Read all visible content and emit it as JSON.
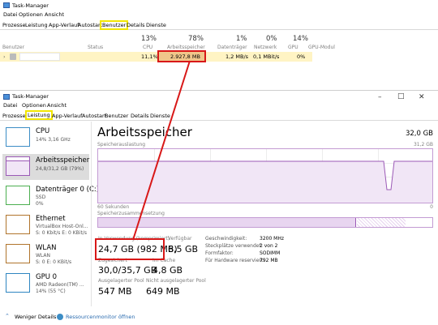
{
  "top_window": {
    "title": "Task-Manager",
    "menu": [
      "Datei",
      "Optionen",
      "Ansicht"
    ],
    "tabs": [
      "Prozesse",
      "Leistung",
      "App-Verlauf",
      "Autostart",
      "Benutzer",
      "Details",
      "Dienste"
    ],
    "highlighted_tab": "Benutzer",
    "percentages": {
      "cpu": "13%",
      "ram": "78%",
      "disk": "1%",
      "network": "0%",
      "gpu": "14%"
    },
    "columns": [
      "Benutzer",
      "Status",
      "CPU",
      "Arbeitsspeicher",
      "Datenträger",
      "Netzwerk",
      "GPU",
      "GPU-Modul"
    ],
    "row": {
      "cpu": "11,1%",
      "ram": "2.927,8 MB",
      "disk": "1,2 MB/s",
      "network": "0,1 MBit/s",
      "gpu": "0%"
    }
  },
  "bottom_window": {
    "title": "Task-Manager",
    "menu": [
      "Datei",
      "Optionen",
      "Ansicht"
    ],
    "tabs": [
      "Prozesse",
      "Leistung",
      "App-Verlauf",
      "Autostart",
      "Benutzer",
      "Details",
      "Dienste"
    ],
    "highlighted_tab": "Leistung",
    "sidebar": [
      {
        "name": "CPU",
        "sub1": "14%  3,16 GHz",
        "sub2": ""
      },
      {
        "name": "Arbeitsspeicher",
        "sub1": "24,8/31,2 GB (79%)",
        "sub2": ""
      },
      {
        "name": "Datenträger 0 (C:)",
        "sub1": "SSD",
        "sub2": "0%"
      },
      {
        "name": "Ethernet",
        "sub1": "VirtualBox Host-Onl...",
        "sub2": "S: 0 Kbit/s E: 0 KBit/s"
      },
      {
        "name": "WLAN",
        "sub1": "WLAN",
        "sub2": "S: 0 E: 0 KBit/s"
      },
      {
        "name": "GPU 0",
        "sub1": "AMD Radeon(TM) ...",
        "sub2": "14% (55 °C)"
      }
    ],
    "content": {
      "title": "Arbeitsspeicher",
      "total": "32,0 GB",
      "usage_label": "Speicherauslastung",
      "usage_max": "31,2 GB",
      "axis_left": "60 Sekunden",
      "axis_right": "0",
      "composition_label": "Speicherzusammensetzung",
      "in_use_label": "In Verwendung (komprimiert)",
      "in_use_value": "24,7 GB (982 MB)",
      "available_label": "Verfügbar",
      "available_value": "6,5 GB",
      "committed_label": "Zugesichert",
      "committed_value": "30,0/35,7 GB",
      "cached_label": "Im Cache",
      "cached_value": "4,8 GB",
      "paged_label": "Ausgelagerter Pool",
      "paged_value": "547 MB",
      "nonpaged_label": "Nicht ausgelagerter Pool",
      "nonpaged_value": "649 MB",
      "specs": [
        {
          "k": "Geschwindigkeit:",
          "v": "3200 MHz"
        },
        {
          "k": "Steckplätze verwendet:",
          "v": "2 von 2"
        },
        {
          "k": "Formfaktor:",
          "v": "SODIMM"
        },
        {
          "k": "Für Hardware reserviert:",
          "v": "792 MB"
        }
      ]
    },
    "footer": {
      "less_details": "Weniger Details",
      "resource_monitor": "Ressourcenmonitor öffnen"
    }
  },
  "colors": {
    "highlight_yellow": "#f2e600",
    "annotation_red": "#d81818",
    "memory_purple": "#9b59b6",
    "row_highlight": "#fff4c4"
  }
}
